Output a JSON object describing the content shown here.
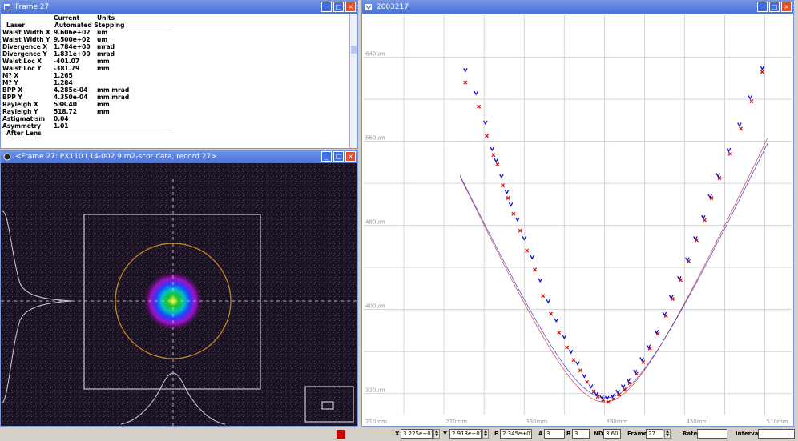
{
  "results": {
    "title": "Frame 27",
    "col_current": "Current",
    "col_units": "Units",
    "section_laser_left": "Laser",
    "section_laser_right": "Automated Stepping",
    "section_after": "After Lens",
    "rows": [
      {
        "label": "Waist Width X",
        "value": "9.606e+02",
        "unit": "um"
      },
      {
        "label": "Waist Width Y",
        "value": "9.500e+02",
        "unit": "um"
      },
      {
        "label": "Divergence X",
        "value": "1.784e+00",
        "unit": "mrad"
      },
      {
        "label": "Divergence Y",
        "value": "1.831e+00",
        "unit": "mrad"
      },
      {
        "label": "Waist Loc X",
        "value": "-401.07",
        "unit": "mm"
      },
      {
        "label": "Waist Loc Y",
        "value": "-381.79",
        "unit": "mm"
      },
      {
        "label": "M? X",
        "value": "1.265",
        "unit": ""
      },
      {
        "label": "M? Y",
        "value": "1.284",
        "unit": ""
      },
      {
        "label": "BPP X",
        "value": "4.285e-04",
        "unit": "mm mrad"
      },
      {
        "label": "BPP Y",
        "value": "4.350e-04",
        "unit": "mm mrad"
      },
      {
        "label": "Rayleigh X",
        "value": "538.40",
        "unit": "mm"
      },
      {
        "label": "Rayleigh Y",
        "value": "518.72",
        "unit": "mm"
      },
      {
        "label": "Astigmatism",
        "value": "0.04",
        "unit": ""
      },
      {
        "label": "Asymmetry",
        "value": "1.01",
        "unit": ""
      }
    ]
  },
  "beam": {
    "title": "<Frame 27: PX110 L14-002.9.m2-scor data, record 27>"
  },
  "plot": {
    "title": "2003217",
    "colors": {
      "x_series": "#d01010",
      "y_series": "#1010d0",
      "grid": "#cccccc"
    }
  },
  "chart_data": {
    "type": "scatter",
    "title": "",
    "xlabel": "",
    "ylabel": "",
    "xlim": [
      210,
      530
    ],
    "ylim": [
      300,
      680
    ],
    "x_ticks": [
      "210mm",
      "270mm",
      "330mm",
      "390mm",
      "450mm",
      "510mm"
    ],
    "y_ticks": [
      "640um",
      "560um",
      "480um",
      "400um",
      "320um"
    ],
    "y_tick_values": [
      640,
      560,
      480,
      400,
      320
    ],
    "x_tick_values": [
      210,
      270,
      330,
      390,
      450,
      510
    ],
    "series": [
      {
        "marker": "x",
        "color": "#d01010",
        "points": [
          [
            286,
            616
          ],
          [
            296,
            593
          ],
          [
            302,
            565
          ],
          [
            307,
            547
          ],
          [
            310,
            538
          ],
          [
            314,
            518
          ],
          [
            318,
            506
          ],
          [
            322,
            491
          ],
          [
            327,
            475
          ],
          [
            332,
            456
          ],
          [
            338,
            438
          ],
          [
            344,
            413
          ],
          [
            350,
            396
          ],
          [
            356,
            378
          ],
          [
            362,
            364
          ],
          [
            367,
            352
          ],
          [
            372,
            342
          ],
          [
            377,
            331
          ],
          [
            382,
            322
          ],
          [
            385,
            317
          ],
          [
            389,
            314
          ],
          [
            393,
            312
          ],
          [
            397,
            315
          ],
          [
            401,
            319
          ],
          [
            405,
            324
          ],
          [
            409,
            330
          ],
          [
            414,
            339
          ],
          [
            419,
            350
          ],
          [
            424,
            363
          ],
          [
            430,
            377
          ],
          [
            436,
            394
          ],
          [
            441,
            410
          ],
          [
            447,
            428
          ],
          [
            453,
            446
          ],
          [
            459,
            466
          ],
          [
            465,
            485
          ],
          [
            470,
            506
          ],
          [
            476,
            525
          ],
          [
            484,
            548
          ],
          [
            492,
            572
          ],
          [
            500,
            598
          ],
          [
            508,
            626
          ]
        ]
      },
      {
        "marker": "v",
        "color": "#1010d0",
        "points": [
          [
            286,
            628
          ],
          [
            294,
            606
          ],
          [
            301,
            578
          ],
          [
            306,
            553
          ],
          [
            309,
            542
          ],
          [
            313,
            527
          ],
          [
            317,
            512
          ],
          [
            320,
            500
          ],
          [
            325,
            486
          ],
          [
            330,
            468
          ],
          [
            336,
            450
          ],
          [
            342,
            428
          ],
          [
            348,
            408
          ],
          [
            354,
            390
          ],
          [
            360,
            374
          ],
          [
            365,
            360
          ],
          [
            370,
            349
          ],
          [
            375,
            337
          ],
          [
            380,
            327
          ],
          [
            384,
            320
          ],
          [
            388,
            317
          ],
          [
            392,
            316
          ],
          [
            396,
            318
          ],
          [
            400,
            322
          ],
          [
            404,
            327
          ],
          [
            408,
            333
          ],
          [
            413,
            341
          ],
          [
            418,
            353
          ],
          [
            423,
            365
          ],
          [
            429,
            379
          ],
          [
            435,
            396
          ],
          [
            440,
            412
          ],
          [
            446,
            430
          ],
          [
            452,
            448
          ],
          [
            458,
            468
          ],
          [
            464,
            488
          ],
          [
            469,
            508
          ],
          [
            475,
            528
          ],
          [
            483,
            552
          ],
          [
            491,
            576
          ],
          [
            499,
            602
          ],
          [
            508,
            630
          ]
        ]
      }
    ],
    "fit_curves": [
      {
        "color": "#d01010",
        "waist_x": 390,
        "waist_y": 312,
        "k": 0.0198
      },
      {
        "color": "#1010d0",
        "waist_x": 391,
        "waist_y": 316,
        "k": 0.0194
      }
    ]
  },
  "status": {
    "x_label": "X",
    "x_value": "3.225e+03",
    "y_label": "Y",
    "y_value": "2.913e+03",
    "e_label": "E",
    "e_value": "2.345e+03",
    "a_label": "A",
    "a_value": "3",
    "b_label": "B",
    "b_value": "3",
    "nd_label": "ND",
    "nd_value": "3.60",
    "frame_label": "Frame",
    "frame_value": "27",
    "rate_label": "Rate",
    "rate_value": "",
    "interval_label": "Interval",
    "interval_value": ""
  }
}
